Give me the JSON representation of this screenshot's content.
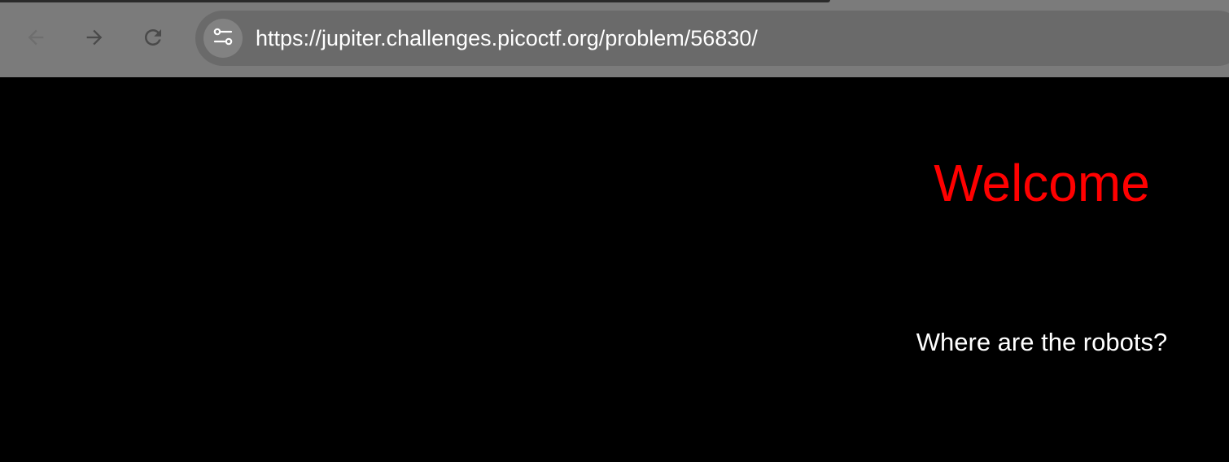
{
  "browser": {
    "nav": {
      "back_icon": "arrow-left-icon",
      "forward_icon": "arrow-right-icon",
      "reload_icon": "reload-icon"
    },
    "address_bar": {
      "site_info_icon": "tune-icon",
      "url": "https://jupiter.challenges.picoctf.org/problem/56830/"
    }
  },
  "page": {
    "heading": "Welcome",
    "subtext": "Where are the robots?",
    "colors": {
      "background": "#000000",
      "heading": "#ff0000",
      "subtext": "#ffffff"
    }
  }
}
